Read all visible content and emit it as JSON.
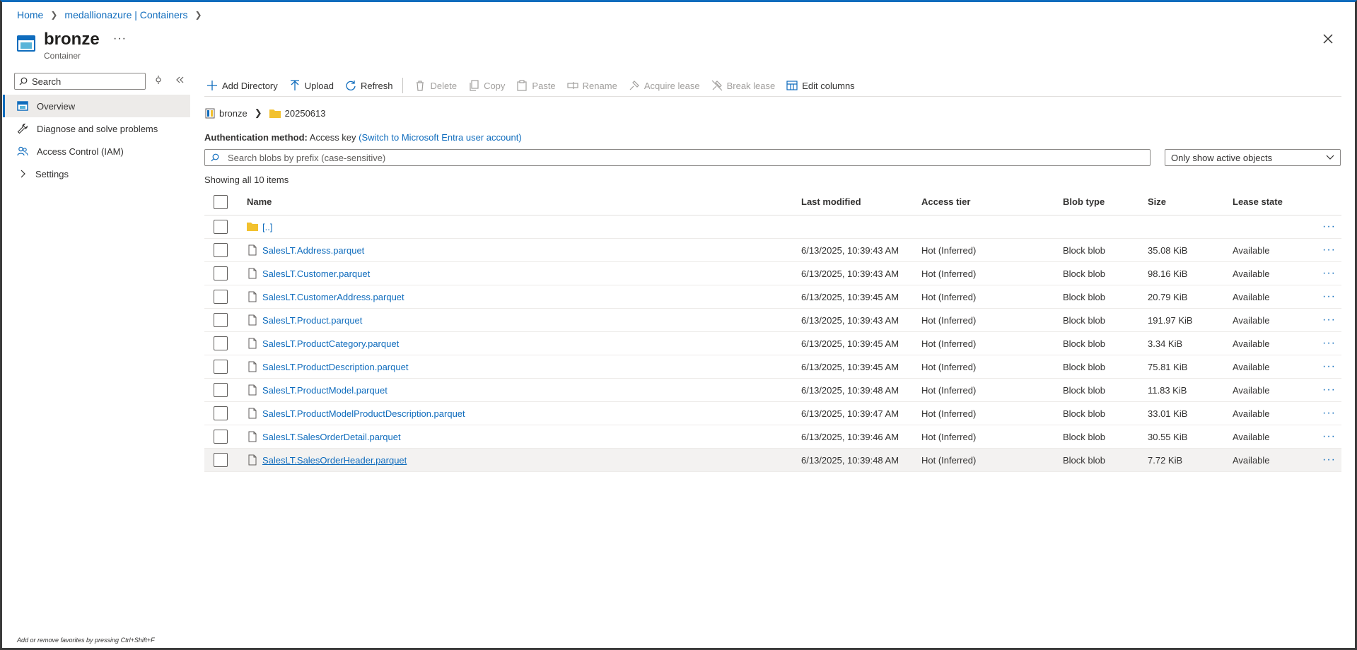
{
  "breadcrumb": {
    "items": [
      "Home",
      "medallionazure | Containers"
    ]
  },
  "header": {
    "title": "bronze",
    "subtitle": "Container",
    "more": "···"
  },
  "nav": {
    "search_placeholder": "Search",
    "items": [
      {
        "label": "Overview",
        "icon": "overview-icon",
        "active": true
      },
      {
        "label": "Diagnose and solve problems",
        "icon": "wrench-icon"
      },
      {
        "label": "Access Control (IAM)",
        "icon": "people-icon"
      },
      {
        "label": "Settings",
        "icon": "chevron-right-icon"
      }
    ],
    "footer_hint": "Add or remove favorites by pressing Ctrl+Shift+F"
  },
  "toolbar": {
    "add_directory": "Add Directory",
    "upload": "Upload",
    "refresh": "Refresh",
    "delete": "Delete",
    "copy": "Copy",
    "paste": "Paste",
    "rename": "Rename",
    "acquire_lease": "Acquire lease",
    "break_lease": "Break lease",
    "edit_columns": "Edit columns"
  },
  "path": {
    "container": "bronze",
    "folder": "20250613"
  },
  "auth": {
    "label": "Authentication method:",
    "value": "Access key",
    "switch_link": "(Switch to Microsoft Entra user account)"
  },
  "blob_search": {
    "placeholder": "Search blobs by prefix (case-sensitive)"
  },
  "filter": {
    "selected": "Only show active objects"
  },
  "showing": "Showing all 10 items",
  "table": {
    "columns": {
      "name": "Name",
      "modified": "Last modified",
      "tier": "Access tier",
      "type": "Blob type",
      "size": "Size",
      "lease": "Lease state"
    },
    "parent_label": "[..]",
    "more": "···",
    "rows": [
      {
        "name": "SalesLT.Address.parquet",
        "modified": "6/13/2025, 10:39:43 AM",
        "tier": "Hot (Inferred)",
        "type": "Block blob",
        "size": "35.08 KiB",
        "lease": "Available"
      },
      {
        "name": "SalesLT.Customer.parquet",
        "modified": "6/13/2025, 10:39:43 AM",
        "tier": "Hot (Inferred)",
        "type": "Block blob",
        "size": "98.16 KiB",
        "lease": "Available"
      },
      {
        "name": "SalesLT.CustomerAddress.parquet",
        "modified": "6/13/2025, 10:39:45 AM",
        "tier": "Hot (Inferred)",
        "type": "Block blob",
        "size": "20.79 KiB",
        "lease": "Available"
      },
      {
        "name": "SalesLT.Product.parquet",
        "modified": "6/13/2025, 10:39:43 AM",
        "tier": "Hot (Inferred)",
        "type": "Block blob",
        "size": "191.97 KiB",
        "lease": "Available"
      },
      {
        "name": "SalesLT.ProductCategory.parquet",
        "modified": "6/13/2025, 10:39:45 AM",
        "tier": "Hot (Inferred)",
        "type": "Block blob",
        "size": "3.34 KiB",
        "lease": "Available"
      },
      {
        "name": "SalesLT.ProductDescription.parquet",
        "modified": "6/13/2025, 10:39:45 AM",
        "tier": "Hot (Inferred)",
        "type": "Block blob",
        "size": "75.81 KiB",
        "lease": "Available"
      },
      {
        "name": "SalesLT.ProductModel.parquet",
        "modified": "6/13/2025, 10:39:48 AM",
        "tier": "Hot (Inferred)",
        "type": "Block blob",
        "size": "11.83 KiB",
        "lease": "Available"
      },
      {
        "name": "SalesLT.ProductModelProductDescription.parquet",
        "modified": "6/13/2025, 10:39:47 AM",
        "tier": "Hot (Inferred)",
        "type": "Block blob",
        "size": "33.01 KiB",
        "lease": "Available"
      },
      {
        "name": "SalesLT.SalesOrderDetail.parquet",
        "modified": "6/13/2025, 10:39:46 AM",
        "tier": "Hot (Inferred)",
        "type": "Block blob",
        "size": "30.55 KiB",
        "lease": "Available"
      },
      {
        "name": "SalesLT.SalesOrderHeader.parquet",
        "modified": "6/13/2025, 10:39:48 AM",
        "tier": "Hot (Inferred)",
        "type": "Block blob",
        "size": "7.72 KiB",
        "lease": "Available",
        "hovered": true
      }
    ]
  },
  "colors": {
    "accent": "#0f6cbd",
    "folder": "#f2c12e",
    "border": "#8a8886"
  }
}
